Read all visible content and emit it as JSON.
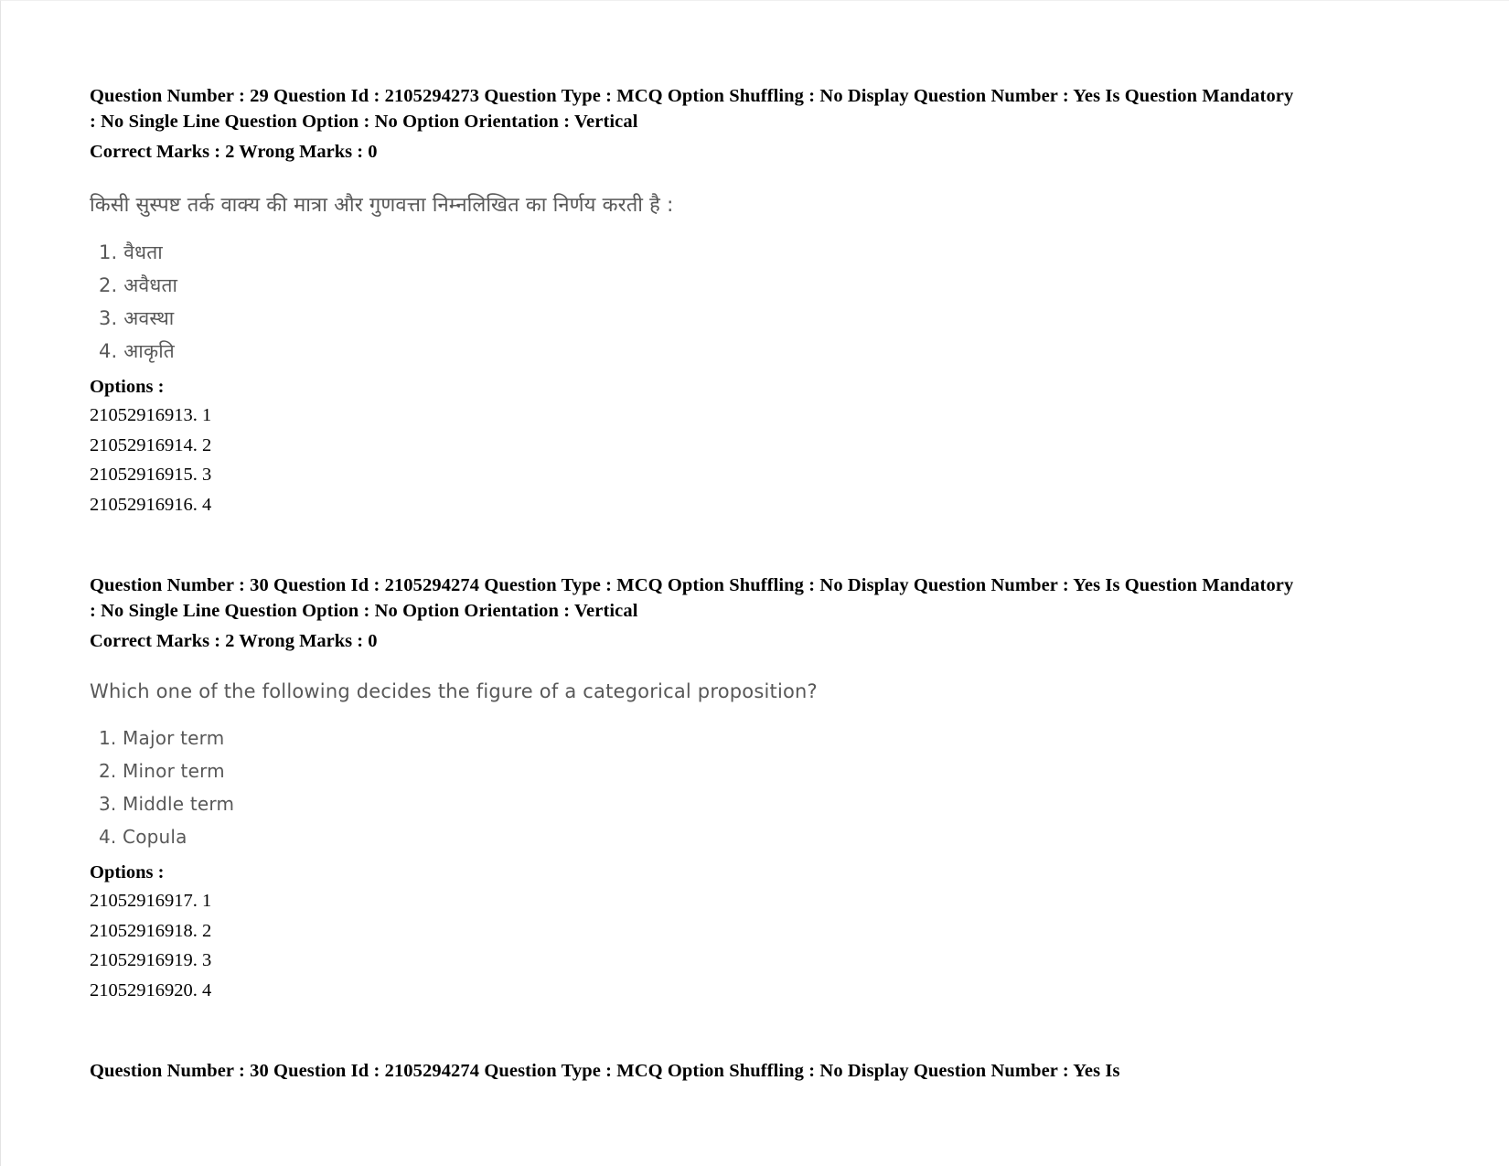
{
  "page": {
    "background_color": "#ffffff",
    "text_color": "#000000",
    "scan_text_color": "#4a4a4a"
  },
  "questions": [
    {
      "meta_line_1": "Question Number : 29 Question Id : 2105294273 Question Type : MCQ Option Shuffling : No Display Question Number : Yes Is Question Mandatory : No Single Line Question Option : No Option Orientation : Vertical",
      "meta_line_2": "Correct Marks : 2 Wrong Marks : 0",
      "question_text": "किसी सुस्पष्ट तर्क वाक्य की मात्रा और गुणवत्ता निम्नलिखित का निर्णय करती है :",
      "language": "hindi",
      "choices": [
        "1. वैधता",
        "2. अवैधता",
        "3. अवस्था",
        "4. आकृति"
      ],
      "options_label": "Options :",
      "options": [
        "21052916913. 1",
        "21052916914. 2",
        "21052916915. 3",
        "21052916916. 4"
      ]
    },
    {
      "meta_line_1": "Question Number : 30 Question Id : 2105294274 Question Type : MCQ Option Shuffling : No Display Question Number : Yes Is Question Mandatory : No Single Line Question Option : No Option Orientation : Vertical",
      "meta_line_2": "Correct Marks : 2 Wrong Marks : 0",
      "question_text": "Which one of the following decides the figure of a categorical proposition?",
      "language": "english",
      "choices": [
        "1. Major term",
        "2. Minor term",
        "3. Middle term",
        "4. Copula"
      ],
      "options_label": "Options :",
      "options": [
        "21052916917. 1",
        "21052916918. 2",
        "21052916919. 3",
        "21052916920. 4"
      ]
    }
  ],
  "trailing_meta_line": "Question Number : 30 Question Id : 2105294274 Question Type : MCQ Option Shuffling : No Display Question Number : Yes Is"
}
